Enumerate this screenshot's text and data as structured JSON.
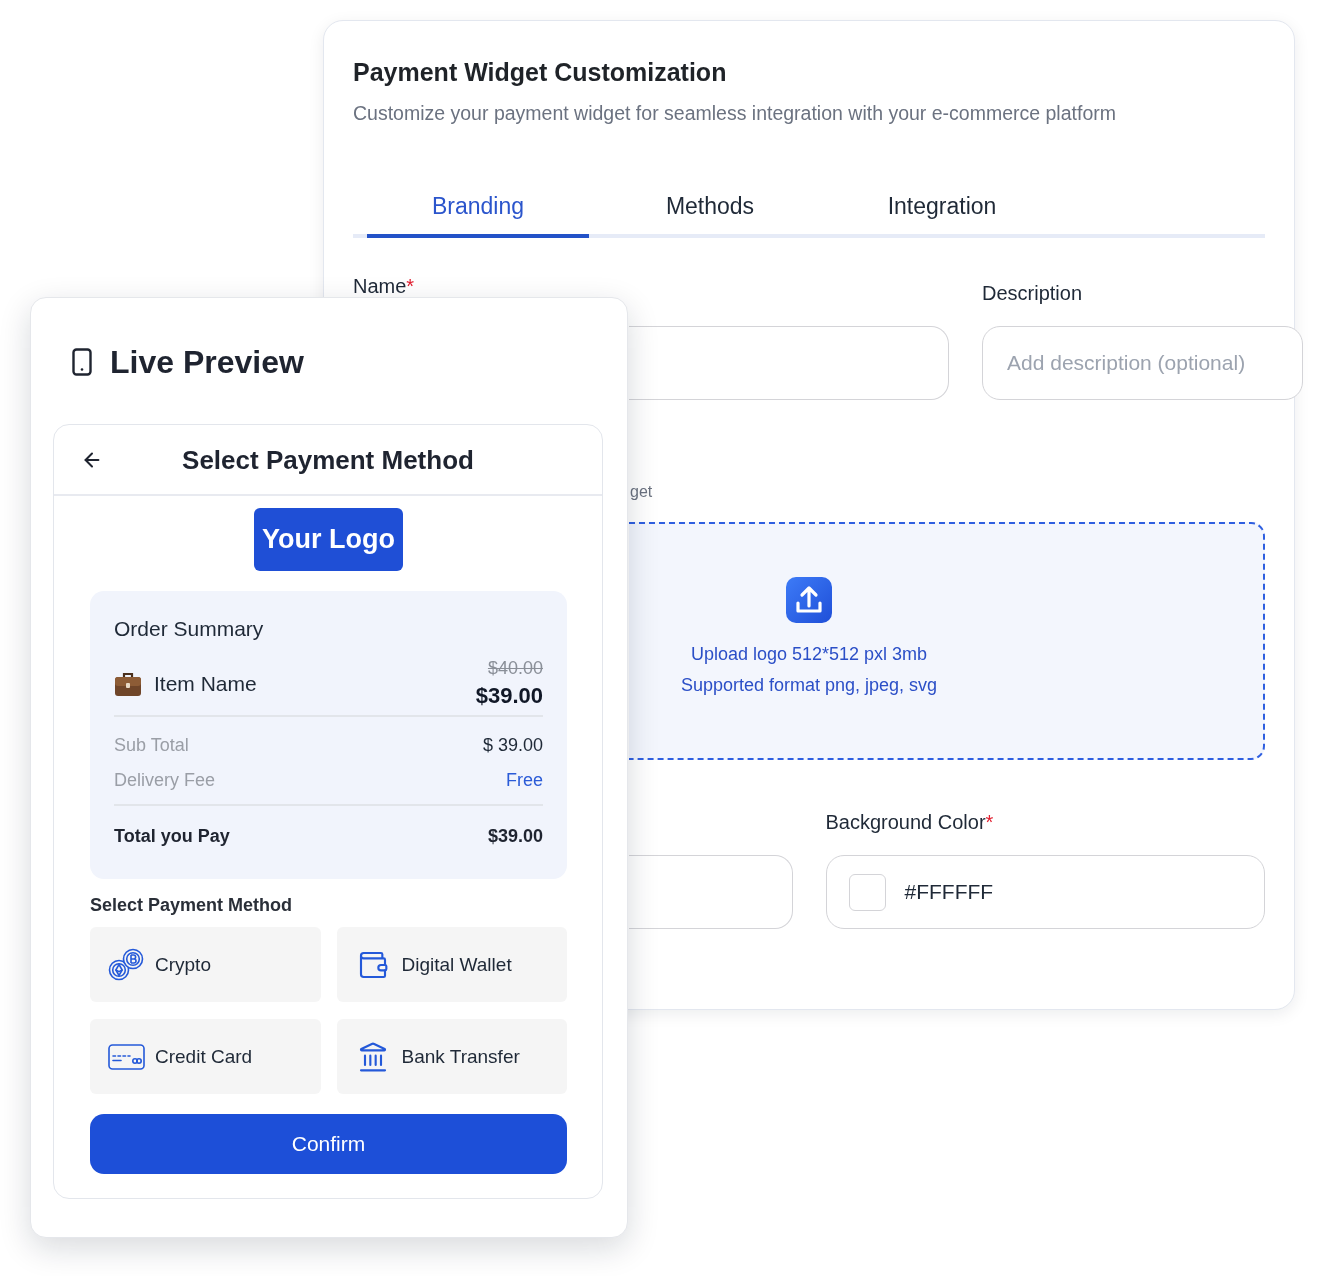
{
  "settings_panel": {
    "title": "Payment Widget Customization",
    "subtitle": "Customize your payment widget for seamless integration with your e-commerce platform",
    "tabs": [
      {
        "label": "Branding",
        "selected": true
      },
      {
        "label": "Methods",
        "selected": false
      },
      {
        "label": "Integration",
        "selected": false
      }
    ],
    "name_field": {
      "label": "Name",
      "required_mark": "*"
    },
    "description_field": {
      "label": "Description",
      "placeholder": "Add description (optional)"
    },
    "logo_hint": "get",
    "upload": {
      "size_note": "Upload logo 512*512 pxl 3mb",
      "format_note": "Supported format png, jpeg, svg"
    },
    "background_color_field": {
      "label": "Background Color",
      "required_mark": "*",
      "value": "#FFFFFF"
    }
  },
  "preview_panel": {
    "title": "Live Preview",
    "widget": {
      "title": "Select Payment Method",
      "logo_text": "Your Logo",
      "order_summary": {
        "title": "Order Summary",
        "item": {
          "name": "Item Name",
          "old_price": "$40.00",
          "price": "$39.00"
        },
        "lines": [
          {
            "label": "Sub Total",
            "value": "$ 39.00",
            "kind": "plain"
          },
          {
            "label": "Delivery Fee",
            "value": "Free",
            "kind": "highlight"
          }
        ],
        "total": {
          "label": "Total you Pay",
          "value": "$39.00"
        }
      },
      "methods_heading": "Select Payment Method",
      "methods": [
        {
          "label": "Crypto"
        },
        {
          "label": "Digital Wallet"
        },
        {
          "label": "Credit Card"
        },
        {
          "label": "Bank Transfer"
        }
      ],
      "confirm_label": "Confirm"
    }
  }
}
